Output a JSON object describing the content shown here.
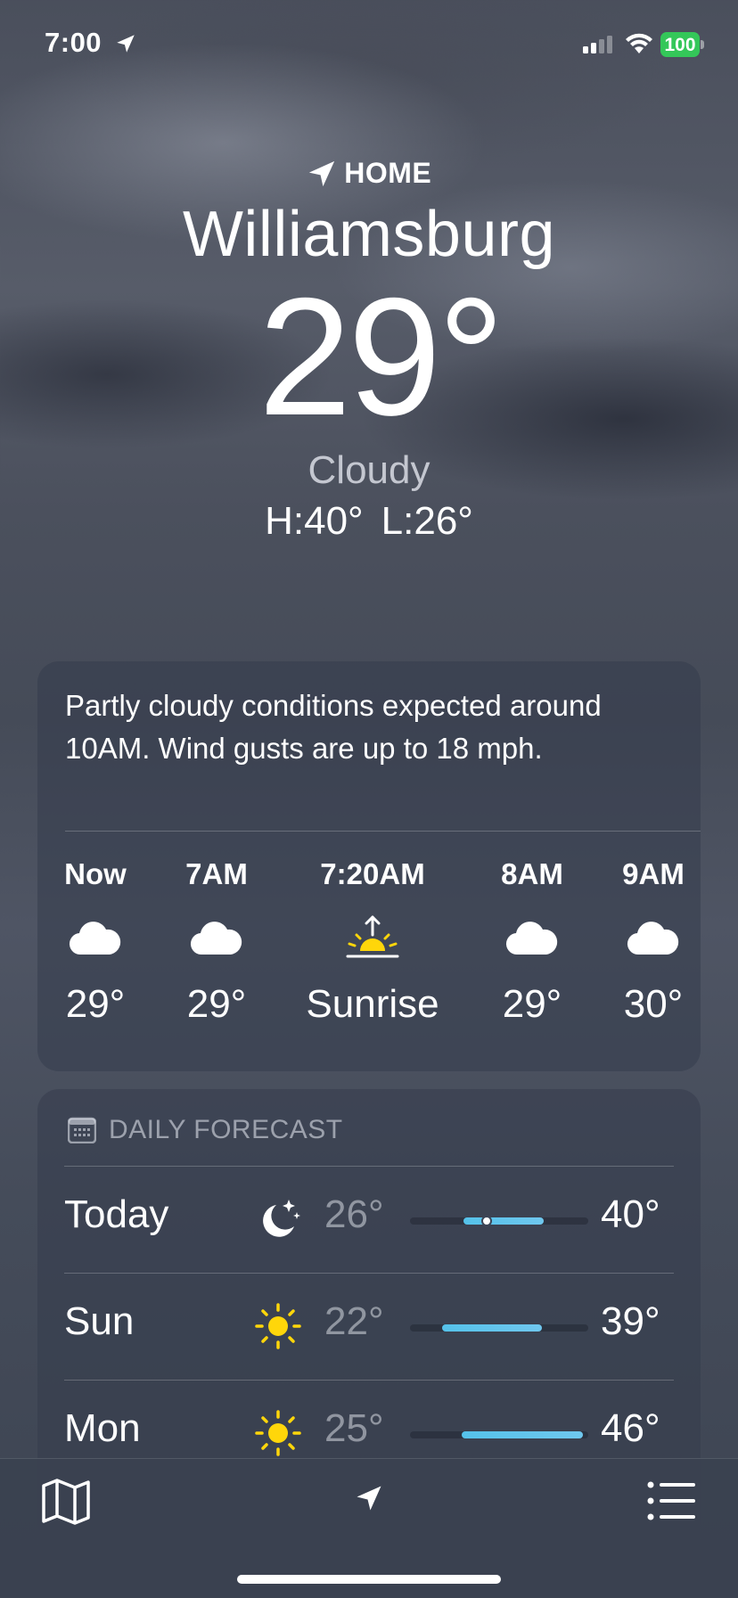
{
  "status_bar": {
    "time": "7:00",
    "battery": "100",
    "battery_color": "#34c759"
  },
  "header": {
    "location_tag": "HOME",
    "city": "Williamsburg",
    "temperature": "29°",
    "condition": "Cloudy",
    "high": "H:40°",
    "low": "L:26°"
  },
  "hourly": {
    "summary_parts": [
      "Partly cloudy conditions expected around 10",
      "AM",
      ". Wind gusts are up to 18 mph."
    ],
    "items": [
      {
        "label": "Now",
        "icon": "cloud-icon",
        "value": "29°"
      },
      {
        "label": "7AM",
        "icon": "cloud-icon",
        "value": "29°"
      },
      {
        "label": "7:20AM",
        "icon": "sunrise-icon",
        "value": "Sunrise"
      },
      {
        "label": "8AM",
        "icon": "cloud-icon",
        "value": "29°"
      },
      {
        "label": "9AM",
        "icon": "cloud-icon",
        "value": "30°"
      }
    ]
  },
  "daily": {
    "title": "DAILY FORECAST",
    "days": [
      {
        "name": "Today",
        "icon": "moon-stars-icon",
        "low": "26°",
        "high": "40°",
        "range_start": 0.3,
        "range_end": 0.75,
        "current": 0.43
      },
      {
        "name": "Sun",
        "icon": "sun-icon",
        "low": "22°",
        "high": "39°",
        "range_start": 0.18,
        "range_end": 0.74
      },
      {
        "name": "Mon",
        "icon": "sun-icon",
        "low": "25°",
        "high": "46°",
        "range_start": 0.29,
        "range_end": 0.97
      }
    ]
  },
  "toolbar": {
    "map_icon": "map-icon",
    "location_icon": "location-arrow-icon",
    "list_icon": "list-icon"
  },
  "colors": {
    "accent_blue": "#5ac8fa",
    "sun_yellow": "#ffd60a"
  }
}
